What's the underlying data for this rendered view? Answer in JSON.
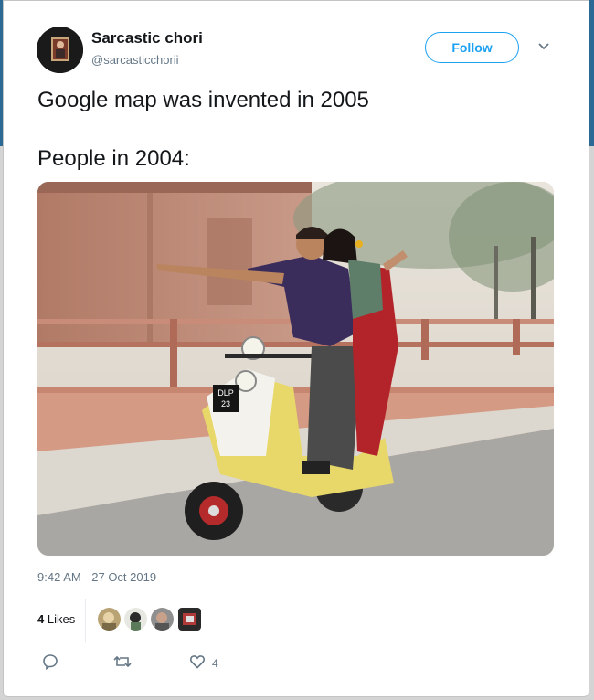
{
  "tweet": {
    "display_name": "Sarcastic chori",
    "handle": "@sarcasticchorii",
    "follow_label": "Follow",
    "text_line1": "Google map was invented in 2005",
    "text_line2": "People in 2004:",
    "timestamp": "9:42 AM - 27 Oct 2019",
    "likes_count": "4",
    "likes_label": "Likes",
    "like_action_count": "4",
    "image": {
      "scooter_plate_line1": "DLP",
      "scooter_plate_line2": "23"
    }
  },
  "colors": {
    "accent": "#1da1f2",
    "text_primary": "#14171a",
    "text_secondary": "#657786",
    "header_bg": "#2c6a95"
  },
  "icons": [
    "chevron-down-icon",
    "reply-icon",
    "retweet-icon",
    "heart-icon"
  ]
}
